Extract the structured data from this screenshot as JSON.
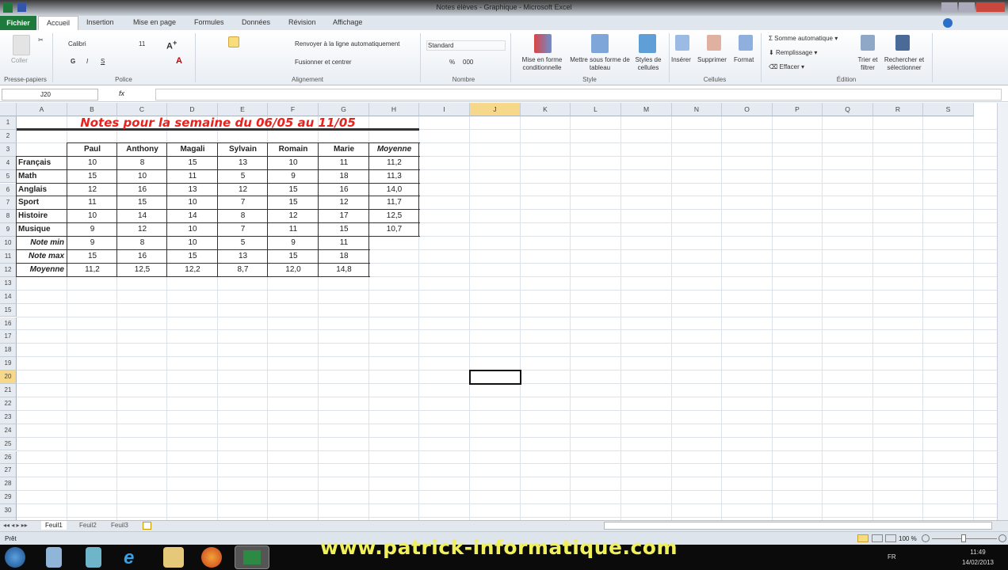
{
  "window": {
    "title": "Notes élèves - Graphique - Microsoft Excel"
  },
  "ribbon_tabs": [
    "Fichier",
    "Accueil",
    "Insertion",
    "Mise en page",
    "Formules",
    "Données",
    "Révision",
    "Affichage"
  ],
  "ribbon": {
    "clipboard": {
      "paste": "Coller",
      "group": "Presse-papiers"
    },
    "font": {
      "name": "Calibri",
      "size": "11",
      "bold": "G",
      "italic": "I",
      "underline": "S",
      "group": "Police"
    },
    "alignment": {
      "wrap": "Renvoyer à la ligne automatiquement",
      "merge": "Fusionner et centrer",
      "group": "Alignement"
    },
    "number": {
      "format": "Standard",
      "percent": "%",
      "thousands": "000",
      "group": "Nombre"
    },
    "style": {
      "conditional": "Mise en forme conditionnelle",
      "table": "Mettre sous forme de tableau",
      "cell_styles": "Styles de cellules",
      "group": "Style"
    },
    "cells": {
      "insert": "Insérer",
      "delete": "Supprimer",
      "format": "Format",
      "group": "Cellules"
    },
    "editing": {
      "autosum": "Somme automatique",
      "fill": "Remplissage",
      "clear": "Effacer",
      "sort": "Trier et filtrer",
      "find": "Rechercher et sélectionner",
      "group": "Édition"
    }
  },
  "formula_bar": {
    "name_box": "J20",
    "fx": "fx",
    "value": ""
  },
  "columns": [
    "A",
    "B",
    "C",
    "D",
    "E",
    "F",
    "G",
    "H",
    "I",
    "J",
    "K",
    "L",
    "M",
    "N",
    "O",
    "P",
    "Q",
    "R",
    "S"
  ],
  "row_count": 31,
  "sheet": {
    "title": "Notes pour la semaine du 06/05 au 11/05",
    "headers": [
      "Paul",
      "Anthony",
      "Magali",
      "Sylvain",
      "Romain",
      "Marie",
      "Moyenne"
    ],
    "subjects": [
      {
        "name": "Français",
        "values": [
          "10",
          "8",
          "15",
          "13",
          "10",
          "11",
          "11,2"
        ]
      },
      {
        "name": "Math",
        "values": [
          "15",
          "10",
          "11",
          "5",
          "9",
          "18",
          "11,3"
        ]
      },
      {
        "name": "Anglais",
        "values": [
          "12",
          "16",
          "13",
          "12",
          "15",
          "16",
          "14,0"
        ]
      },
      {
        "name": "Sport",
        "values": [
          "11",
          "15",
          "10",
          "7",
          "15",
          "12",
          "11,7"
        ]
      },
      {
        "name": "Histoire",
        "values": [
          "10",
          "14",
          "14",
          "8",
          "12",
          "17",
          "12,5"
        ]
      },
      {
        "name": "Musique",
        "values": [
          "9",
          "12",
          "10",
          "7",
          "11",
          "15",
          "10,7"
        ]
      }
    ],
    "stats": [
      {
        "name": "Note min",
        "values": [
          "9",
          "8",
          "10",
          "5",
          "9",
          "11"
        ]
      },
      {
        "name": "Note max",
        "values": [
          "15",
          "16",
          "15",
          "13",
          "15",
          "18"
        ]
      },
      {
        "name": "Moyenne",
        "values": [
          "11,2",
          "12,5",
          "12,2",
          "8,7",
          "12,0",
          "14,8"
        ]
      }
    ],
    "selected_cell": "J20"
  },
  "sheet_tabs": [
    "Feuil1",
    "Feuil2",
    "Feuil3"
  ],
  "status": {
    "ready": "Prêt",
    "zoom": "100 %"
  },
  "taskbar": {
    "lang": "FR",
    "time": "11:49",
    "date": "14/02/2013"
  },
  "watermark": "www.patrick-informatique.com"
}
